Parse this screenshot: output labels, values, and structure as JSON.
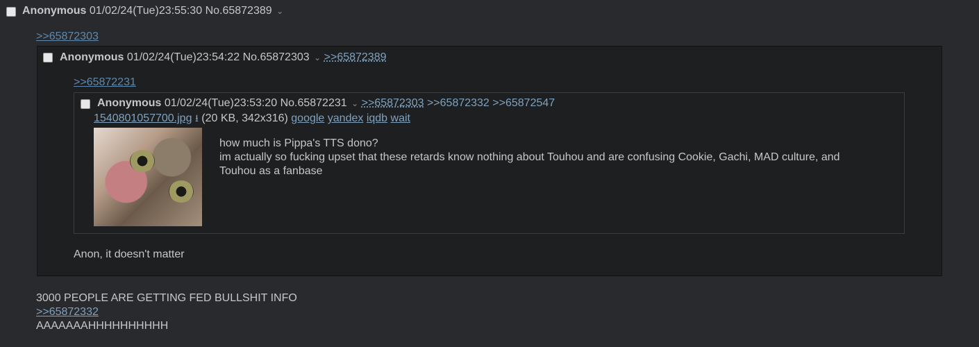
{
  "outer": {
    "name": "Anonymous",
    "datetime": "01/02/24(Tue)23:55:30",
    "postno": "No.65872389",
    "quote_link": ">>65872303",
    "line1": "3000 PEOPLE ARE GETTING FED BULLSHIT INFO",
    "quote_link2": ">>65872332",
    "line2": "AAAAAAAHHHHHHHHHH"
  },
  "mid": {
    "name": "Anonymous",
    "datetime": "01/02/24(Tue)23:54:22",
    "postno": "No.65872303",
    "backlinks": [
      ">>65872389"
    ],
    "quote_link": ">>65872231",
    "message": "Anon, it doesn't matter"
  },
  "inner": {
    "name": "Anonymous",
    "datetime": "01/02/24(Tue)23:53:20",
    "postno": "No.65872231",
    "backlinks": [
      ">>65872303",
      ">>65872332",
      ">>65872547"
    ],
    "file_name": "1540801057700.jpg",
    "file_info": "(20 KB, 342x316)",
    "search_links": [
      "google",
      "yandex",
      "iqdb",
      "wait"
    ],
    "message_lines": [
      "how much is Pippa's TTS dono?",
      "im actually so fucking upset that these retards know nothing about Touhou and are confusing Cookie, Gachi, MAD culture, and",
      "Touhou as a fanbase"
    ]
  },
  "icons": {
    "menu": "chevron-down-icon",
    "download": "download-icon",
    "select": "checkbox-icon"
  },
  "colors": {
    "bg": "#282a2e",
    "reply_bg": "#1d1f21",
    "link": "#81a2be",
    "text": "#c5c8c6"
  }
}
